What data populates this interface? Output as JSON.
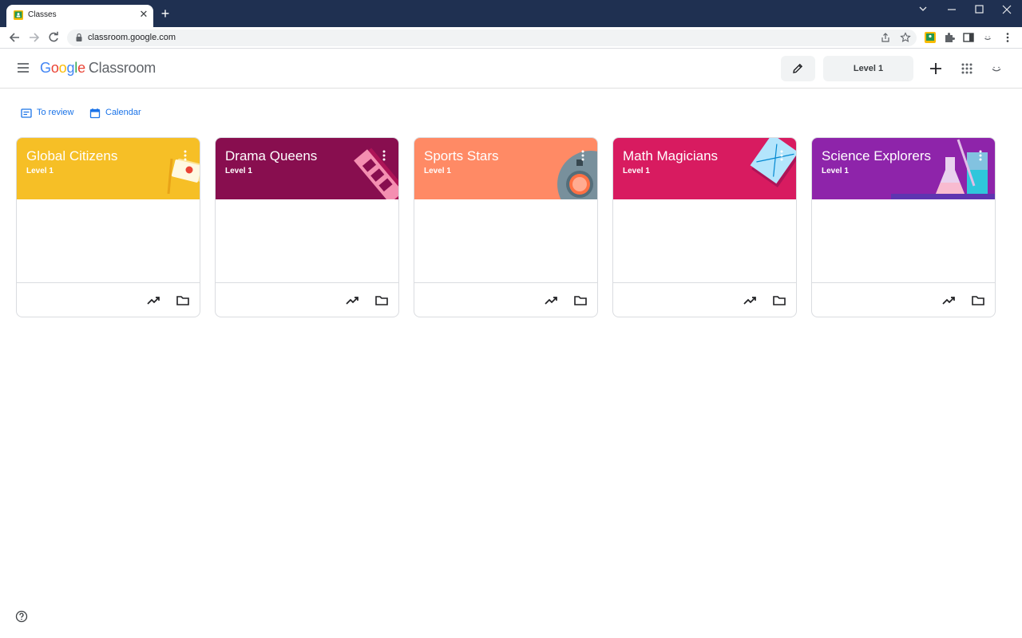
{
  "browser": {
    "tab_title": "Classes",
    "url": "classroom.google.com"
  },
  "header": {
    "logo_parts": [
      "G",
      "o",
      "o",
      "g",
      "l",
      "e"
    ],
    "logo_product": "Classroom",
    "level_label": "Level 1"
  },
  "quick_links": [
    {
      "label": "To review",
      "icon": "assignment-review-icon"
    },
    {
      "label": "Calendar",
      "icon": "calendar-icon"
    }
  ],
  "classes": [
    {
      "name": "Global Citizens",
      "section": "Level 1",
      "color": "#f6bf26"
    },
    {
      "name": "Drama Queens",
      "section": "Level 1",
      "color": "#880e4f"
    },
    {
      "name": "Sports Stars",
      "section": "Level 1",
      "color": "#ff8a65"
    },
    {
      "name": "Math Magicians",
      "section": "Level 1",
      "color": "#d81b60"
    },
    {
      "name": "Science Explorers",
      "section": "Level 1",
      "color": "#8e24aa"
    }
  ]
}
